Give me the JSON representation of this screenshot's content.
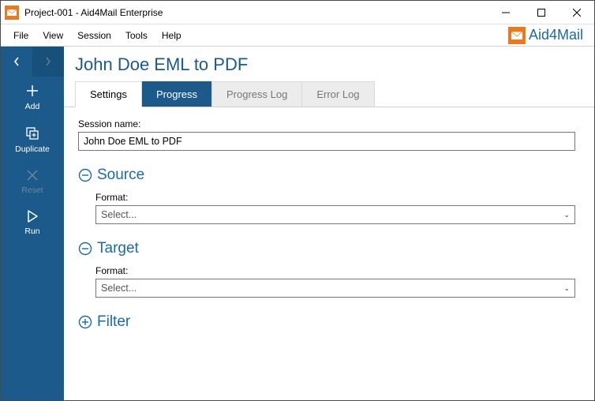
{
  "window": {
    "title": "Project-001 - Aid4Mail Enterprise"
  },
  "menu": {
    "items": [
      "File",
      "View",
      "Session",
      "Tools",
      "Help"
    ]
  },
  "brand": {
    "text": "Aid4Mail"
  },
  "sidebar": {
    "items": [
      {
        "label": "Add"
      },
      {
        "label": "Duplicate"
      },
      {
        "label": "Reset"
      },
      {
        "label": "Run"
      }
    ]
  },
  "header": {
    "title": "John Doe EML to PDF"
  },
  "tabs": {
    "settings": "Settings",
    "progress": "Progress",
    "progress_log": "Progress Log",
    "error_log": "Error Log"
  },
  "settings": {
    "session_name_label": "Session name:",
    "session_name_value": "John Doe EML to PDF",
    "source": {
      "title": "Source",
      "format_label": "Format:",
      "format_value": "Select..."
    },
    "target": {
      "title": "Target",
      "format_label": "Format:",
      "format_value": "Select..."
    },
    "filter": {
      "title": "Filter"
    }
  },
  "colors": {
    "sidebar_bg": "#1b5a8a",
    "accent": "#1b6aa5",
    "brand_orange": "#e87b1f"
  }
}
